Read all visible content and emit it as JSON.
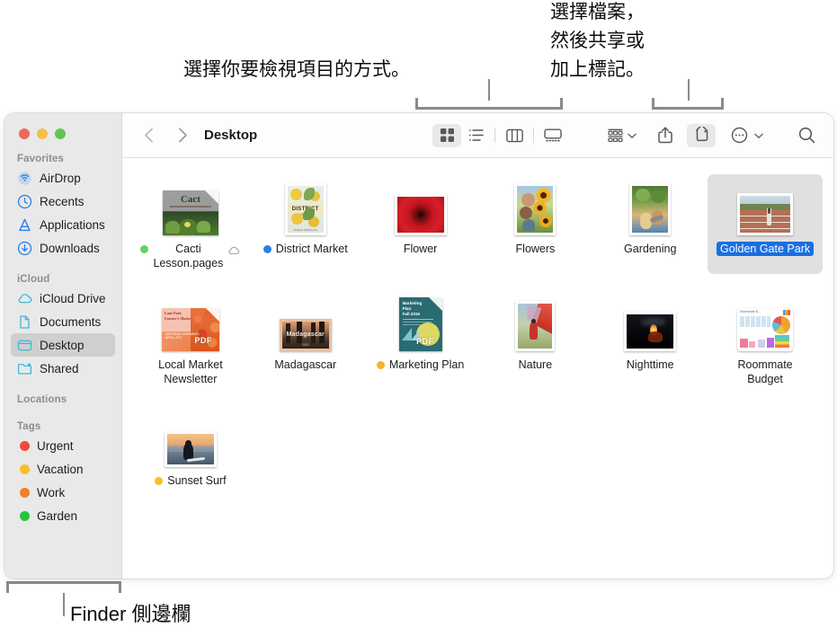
{
  "callouts": {
    "view": "選擇你要檢視項目的方式。",
    "share": "選擇檔案，\n然後共享或\n加上標記。",
    "sidebar": "Finder 側邊欄"
  },
  "window": {
    "title": "Desktop",
    "traffic_lights": [
      "close",
      "minimize",
      "zoom"
    ]
  },
  "toolbar": {
    "back_label": "Back",
    "forward_label": "Forward",
    "views": [
      {
        "name": "icon-view",
        "label": "As Icons",
        "active": true
      },
      {
        "name": "list-view",
        "label": "As List",
        "active": false
      },
      {
        "name": "column-view",
        "label": "As Columns",
        "active": false
      },
      {
        "name": "gallery-view",
        "label": "As Gallery",
        "active": false
      }
    ],
    "group_label": "Group",
    "share_label": "Share",
    "tag_label": "Tags",
    "tag_active": true,
    "more_label": "More",
    "search_label": "Search"
  },
  "sidebar": {
    "sections": [
      {
        "header": "Favorites",
        "items": [
          {
            "label": "AirDrop",
            "icon": "airdrop-icon"
          },
          {
            "label": "Recents",
            "icon": "clock-icon"
          },
          {
            "label": "Applications",
            "icon": "applications-icon"
          },
          {
            "label": "Downloads",
            "icon": "download-icon"
          }
        ]
      },
      {
        "header": "iCloud",
        "items": [
          {
            "label": "iCloud Drive",
            "icon": "cloud-icon"
          },
          {
            "label": "Documents",
            "icon": "document-icon"
          },
          {
            "label": "Desktop",
            "icon": "desktop-icon",
            "selected": true
          },
          {
            "label": "Shared",
            "icon": "shared-folder-icon"
          }
        ]
      },
      {
        "header": "Locations",
        "items": []
      },
      {
        "header": "Tags",
        "items": [
          {
            "label": "Urgent",
            "icon": "tag-dot",
            "color": "#f4483c"
          },
          {
            "label": "Vacation",
            "icon": "tag-dot",
            "color": "#f6c026"
          },
          {
            "label": "Work",
            "icon": "tag-dot",
            "color": "#f0802a"
          },
          {
            "label": "Garden",
            "icon": "tag-dot",
            "color": "#28c63c"
          }
        ]
      }
    ]
  },
  "files": [
    {
      "name": "Cacti\nLesson.pages",
      "kind": "pages-doc-cacti",
      "tag": "#5fd363",
      "cloud": true,
      "selected": false
    },
    {
      "name": "District Market",
      "kind": "photo-district",
      "tag": "#2a7fe8",
      "cloud": false,
      "selected": false
    },
    {
      "name": "Flower",
      "kind": "photo-flower",
      "tag": null,
      "cloud": false,
      "selected": false
    },
    {
      "name": "Flowers",
      "kind": "photo-flowers",
      "tag": null,
      "cloud": false,
      "selected": false
    },
    {
      "name": "Gardening",
      "kind": "photo-gardening",
      "tag": null,
      "cloud": false,
      "selected": false
    },
    {
      "name": "Golden Gate Park",
      "kind": "photo-ggpark",
      "tag": null,
      "cloud": false,
      "selected": true
    },
    {
      "name": "Local Market\nNewsletter",
      "kind": "pdf-market",
      "tag": null,
      "cloud": false,
      "selected": false
    },
    {
      "name": "Madagascar",
      "kind": "photo-madagascar",
      "tag": null,
      "cloud": false,
      "selected": false
    },
    {
      "name": "Marketing Plan",
      "kind": "pdf-marketing",
      "tag": "#f5b52c",
      "cloud": false,
      "selected": false
    },
    {
      "name": "Nature",
      "kind": "photo-nature",
      "tag": null,
      "cloud": false,
      "selected": false
    },
    {
      "name": "Nighttime",
      "kind": "photo-nighttime",
      "tag": null,
      "cloud": false,
      "selected": false
    },
    {
      "name": "Roommate\nBudget",
      "kind": "numbers-budget",
      "tag": null,
      "cloud": false,
      "selected": false
    },
    {
      "name": "Sunset Surf",
      "kind": "photo-sunsetsurf",
      "tag": "#f6c026",
      "cloud": false,
      "selected": false
    }
  ]
}
